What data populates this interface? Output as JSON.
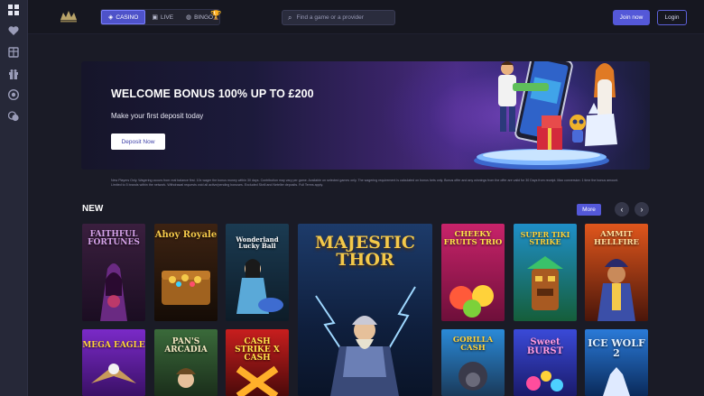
{
  "sidebar": {
    "icons": [
      "grid-icon",
      "heart-icon",
      "gift-box-icon",
      "gift-icon",
      "chip-icon",
      "coins-icon"
    ]
  },
  "topbar": {
    "tabs": [
      {
        "label": "CASINO",
        "icon": "casino-icon",
        "active": true
      },
      {
        "label": "LIVE",
        "icon": "live-icon",
        "active": false
      },
      {
        "label": "BINGO",
        "icon": "bingo-icon",
        "active": false
      }
    ],
    "search_placeholder": "Find a game or a provider",
    "join_label": "Join now",
    "login_label": "Login"
  },
  "hero": {
    "title": "WELCOME BONUS 100% UP TO £200",
    "subtitle": "Make your first deposit today",
    "button_label": "Deposit Now",
    "terms": "New Players Only. Wagering occurs from real balance first. 10x wager the bonus money within 30 days. Contribution may vary per game. Available on selected games only. The wagering requirement is calculated on bonus bets only. Bonus offer and any winnings from the offer are valid for 30 Days from receipt. Max conversion: 1 time the bonus amount. Limited to 5 brands within the network. Withdrawal requests void all active/pending bonuses. Excluded Skrill and Neteller deposits. Full Terms apply."
  },
  "section": {
    "title": "NEW",
    "more_label": "More",
    "prev": "‹",
    "next": "›"
  },
  "games": [
    {
      "title": "FAITHFUL FORTUNES"
    },
    {
      "title": "Ahoy Royale"
    },
    {
      "title": "Wonderland Lucky Ball"
    },
    {
      "title": "MAJESTIC THOR"
    },
    {
      "title": "CHEEKY FRUITS TRIO"
    },
    {
      "title": "SUPER TIKI STRIKE"
    },
    {
      "title": "AMMIT HELLFIRE"
    },
    {
      "title": "MEGA EAGLE"
    },
    {
      "title": "PAN'S ARCADIA"
    },
    {
      "title": "CASH STRIKE X CASH"
    },
    {
      "title": "GORILLA CASH"
    },
    {
      "title": "Sweet BURST"
    },
    {
      "title": "ICE WOLF 2"
    }
  ],
  "colors": {
    "accent": "#5458d8",
    "background": "#1a1b26",
    "sidebar": "#262838"
  }
}
